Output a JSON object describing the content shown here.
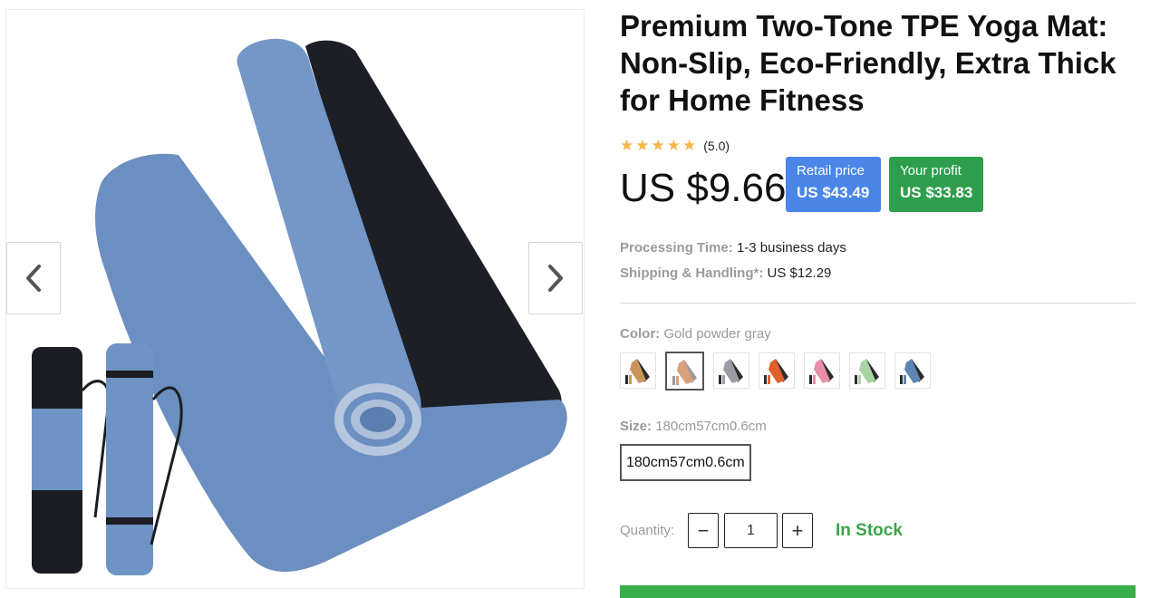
{
  "product": {
    "title": "Premium Two-Tone TPE Yoga Mat: Non-Slip, Eco-Friendly, Extra Thick for Home Fitness",
    "rating_value": "(5.0)",
    "rating_stars": 5,
    "price": "US $9.66",
    "retail_label": "Retail price",
    "retail_value": "US $43.49",
    "profit_label": "Your profit",
    "profit_value": "US $33.83",
    "processing_label": "Processing Time:",
    "processing_value": "1-3 business days",
    "shipping_label": "Shipping & Handling*:",
    "shipping_value": "US $12.29"
  },
  "color": {
    "label": "Color:",
    "selected": "Gold powder gray",
    "swatches": [
      {
        "top": "#c9955a",
        "bottom": "#2b2b2b"
      },
      {
        "top": "#d9a07c",
        "bottom": "#9a9a9a"
      },
      {
        "top": "#9a9ea4",
        "bottom": "#2b2b2b"
      },
      {
        "top": "#e0602c",
        "bottom": "#2b2b2b"
      },
      {
        "top": "#ea8fa8",
        "bottom": "#2b2b2b"
      },
      {
        "top": "#a8d4a4",
        "bottom": "#2b2b2b"
      },
      {
        "top": "#5e86b4",
        "bottom": "#2b2b2b"
      }
    ]
  },
  "size": {
    "label": "Size:",
    "selected": "180cm57cm0.6cm",
    "option": "180cm57cm0.6cm"
  },
  "quantity": {
    "label": "Quantity:",
    "value": "1",
    "stock": "In Stock"
  },
  "colors": {
    "retail_bg": "#4a86e8",
    "profit_bg": "#2e9e4c",
    "stock": "#3aa54a",
    "star": "#f4b54a",
    "mat_blue": "#6c8fc1",
    "mat_dark": "#1c1f26"
  },
  "icons": {
    "prev": "chevron-left-icon",
    "next": "chevron-right-icon",
    "minus": "minus-icon",
    "plus": "plus-icon",
    "star": "star-icon"
  }
}
